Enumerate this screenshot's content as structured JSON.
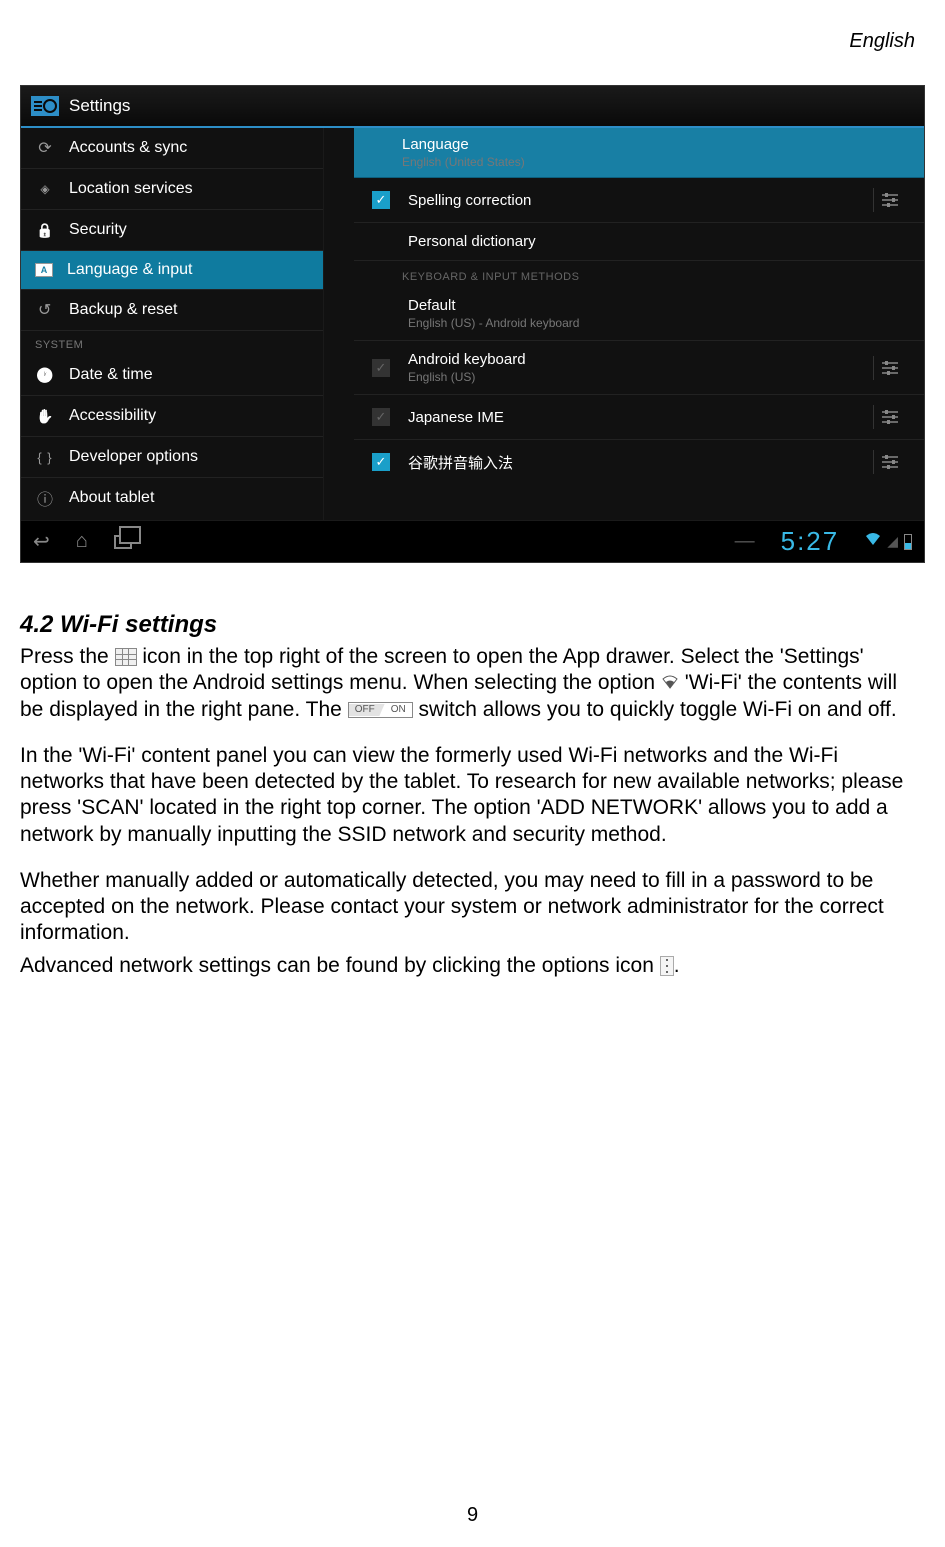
{
  "header": {
    "language": "English"
  },
  "screenshot": {
    "titlebar": "Settings",
    "sidebar": {
      "items": [
        {
          "label": "Accounts & sync",
          "icon": "sync-icon"
        },
        {
          "label": "Location services",
          "icon": "location-icon"
        },
        {
          "label": "Security",
          "icon": "lock-icon"
        },
        {
          "label": "Language & input",
          "icon": "language-icon",
          "selected": true
        },
        {
          "label": "Backup & reset",
          "icon": "backup-icon"
        }
      ],
      "section_header": "SYSTEM",
      "system_items": [
        {
          "label": "Date & time",
          "icon": "clock-icon"
        },
        {
          "label": "Accessibility",
          "icon": "hand-icon"
        },
        {
          "label": "Developer options",
          "icon": "braces-icon"
        },
        {
          "label": "About tablet",
          "icon": "info-icon"
        }
      ]
    },
    "right_pane": {
      "language": {
        "title": "Language",
        "sub": "English (United States)"
      },
      "spelling": {
        "title": "Spelling correction",
        "checked": true
      },
      "dictionary": {
        "title": "Personal dictionary"
      },
      "section_header": "KEYBOARD & INPUT METHODS",
      "default_kb": {
        "title": "Default",
        "sub": "English (US) - Android keyboard"
      },
      "android_kb": {
        "title": "Android keyboard",
        "sub": "English (US)",
        "checked": true
      },
      "japanese": {
        "title": "Japanese IME",
        "checked": true
      },
      "pinyin": {
        "title": "谷歌拼音输入法",
        "checked": true
      }
    },
    "navbar": {
      "time": "5:27"
    }
  },
  "body": {
    "section_title": "4.2 Wi-Fi settings",
    "p1a": "Press the ",
    "p1b": " icon in the top right of the screen to open the App drawer. Select the 'Settings' option to open the Android settings menu. When selecting the option ",
    "p1c": " 'Wi-Fi' the contents will be displayed in the right pane. The ",
    "switch_off": "OFF",
    "switch_on": "ON",
    "p1d": " switch allows you to quickly toggle Wi-Fi on and off.",
    "p2": "In the 'Wi-Fi' content panel you can view the formerly used Wi-Fi networks and the Wi-Fi networks that have been detected by the tablet. To research for new available networks; please press 'SCAN' located in the right top corner. The option 'ADD NETWORK' allows you to add a network by manually inputting the SSID network and security method.",
    "p3": "Whether manually added or automatically detected, you may need to fill in a password to be accepted on the network. Please contact your system or network administrator for the correct information.",
    "p4a": "Advanced network settings can be found by clicking the options icon ",
    "p4b": "."
  },
  "page_number": "9"
}
